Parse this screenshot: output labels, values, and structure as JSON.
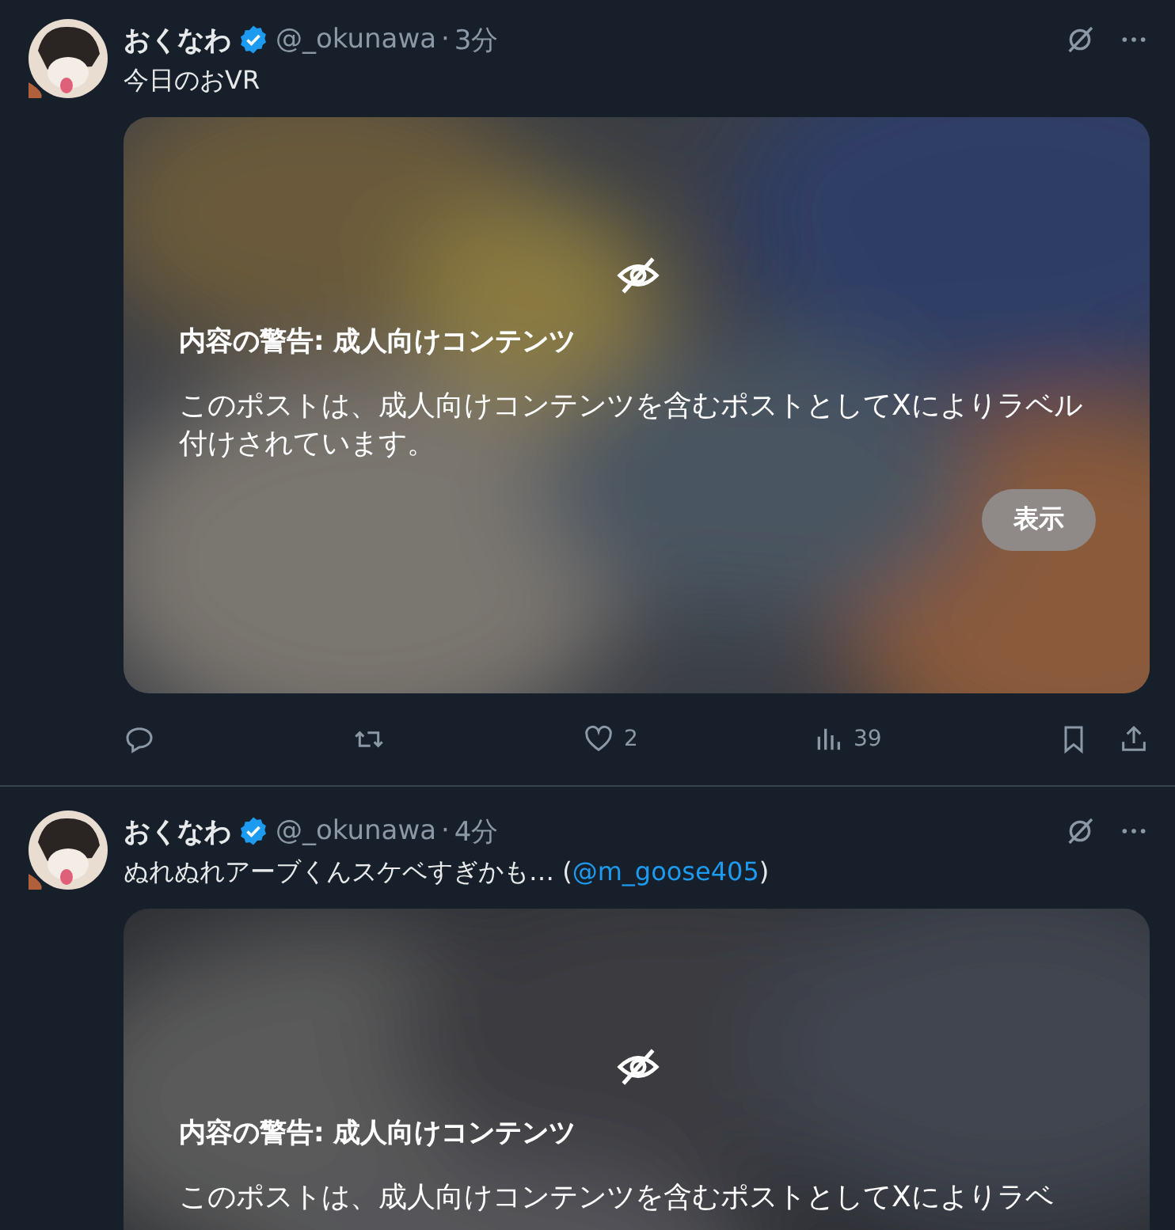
{
  "posts": [
    {
      "name": "おくなわ",
      "verified": true,
      "handle": "@_okunawa",
      "separator": "·",
      "time": "3分",
      "text_parts": [
        {
          "kind": "plain",
          "text": "今日のおVR"
        }
      ],
      "media": {
        "kind": "picture",
        "warning_title": "内容の警告: 成人向けコンテンツ",
        "warning_body": "このポストは、成人向けコンテンツを含むポストとしてXによりラベル付けされています。",
        "show_button": "表示"
      },
      "actions": [
        {
          "kind": "reply"
        },
        {
          "kind": "repost"
        },
        {
          "kind": "like",
          "count": "2"
        },
        {
          "kind": "views",
          "count": "39"
        },
        {
          "kind": "bookmark"
        },
        {
          "kind": "share"
        }
      ]
    },
    {
      "name": "おくなわ",
      "verified": true,
      "handle": "@_okunawa",
      "separator": "·",
      "time": "4分",
      "text_parts": [
        {
          "kind": "plain",
          "text": "ぬれぬれアーブくんスケベすぎかも… ("
        },
        {
          "kind": "mention",
          "text": "@m_goose405"
        },
        {
          "kind": "plain",
          "text": ")"
        }
      ],
      "media": {
        "kind": "picture",
        "warning_title": "内容の警告: 成人向けコンテンツ",
        "warning_body": "このポストは、成人向けコンテンツを含むポストとしてXによりラベ"
      }
    }
  ]
}
